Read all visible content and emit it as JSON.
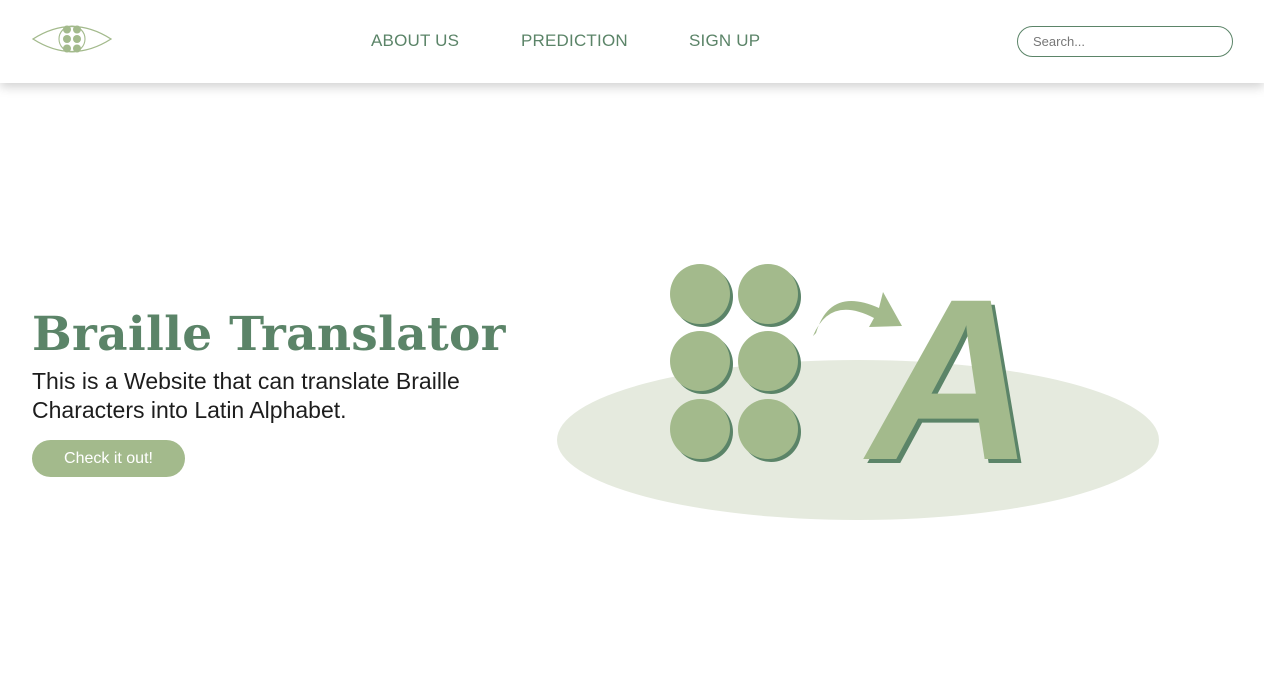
{
  "nav": {
    "links": [
      {
        "label": "ABOUT US"
      },
      {
        "label": "PREDICTION"
      },
      {
        "label": "SIGN UP"
      }
    ],
    "search": {
      "placeholder": "Search...",
      "value": ""
    }
  },
  "hero": {
    "title": "Braille Translator",
    "description": "This is a Website that can translate Braille Characters into Latin Alphabet.",
    "cta_label": "Check it out!"
  },
  "illustration": {
    "letter": "A"
  },
  "colors": {
    "brand_dark": "#5b8468",
    "brand_light": "#a3ba8c",
    "ellipse": "#e5eade",
    "background": "#ffffff"
  },
  "icons": {
    "logo": "eye-braille-logo-icon",
    "braille_cell": "braille-dots-icon",
    "arrow": "curved-arrow-icon"
  }
}
